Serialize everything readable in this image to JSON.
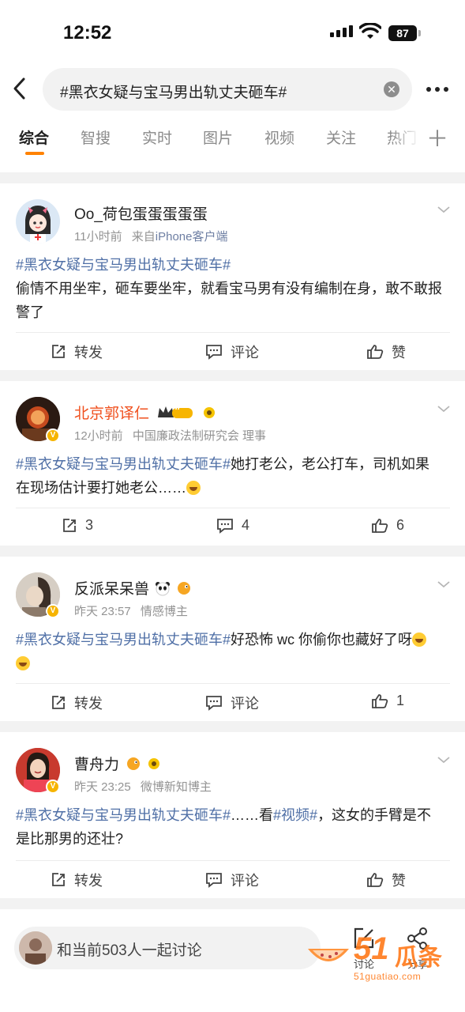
{
  "status_bar": {
    "time": "12:52",
    "battery": "87"
  },
  "search": {
    "query": "#黑衣女疑与宝马男出轨丈夫砸车#"
  },
  "tabs": [
    "综合",
    "智搜",
    "实时",
    "图片",
    "视频",
    "关注",
    "热门"
  ],
  "posts": [
    {
      "username": "Oo_荷包蛋蛋蛋蛋蛋",
      "time": "11小时前",
      "source_prefix": "来自",
      "source": "iPhone客户端",
      "tag": "#黑衣女疑与宝马男出轨丈夫砸车#",
      "text": "偷情不用坐牢，砸车要坐牢，就看宝马男有没有编制在身，敢不敢报警了",
      "repost": "转发",
      "comment": "评论",
      "like": "赞"
    },
    {
      "username": "北京郭译仁",
      "level": "II",
      "time": "12小时前",
      "source": "中国廉政法制研究会 理事",
      "tag": "#黑衣女疑与宝马男出轨丈夫砸车#",
      "text_line1": "她打老公，老公打车，司机如果",
      "text_line2": "在现场估计要打她老公……",
      "repost": "3",
      "comment": "4",
      "like": "6"
    },
    {
      "username": "反派呆呆兽",
      "time": "昨天 23:57",
      "source": "情感博主",
      "tag": "#黑衣女疑与宝马男出轨丈夫砸车#",
      "text": "好恐怖 wc 你偷你也藏好了呀",
      "repost": "转发",
      "comment": "评论",
      "like": "1"
    },
    {
      "username": "曹舟力",
      "time": "昨天 23:25",
      "source": "微博新知博主",
      "tag": "#黑衣女疑与宝马男出轨丈夫砸车#",
      "text_a": "……看",
      "tag2": "#视频#",
      "text_b": "，这女的手臂是不",
      "text_line2": "是比那男的还壮?",
      "repost": "转发",
      "comment": "评论",
      "like": "赞"
    }
  ],
  "bottom_bar": {
    "placeholder": "和当前503人一起讨论",
    "comment_label": "讨论",
    "share_label": "分享"
  },
  "watermark": {
    "brand_num": "51",
    "brand_zh": "瓜条",
    "url": "51guatiao.com"
  },
  "colors": {
    "accent": "#ff8200",
    "link": "#4f6fa6",
    "vip_name": "#f0501e"
  }
}
